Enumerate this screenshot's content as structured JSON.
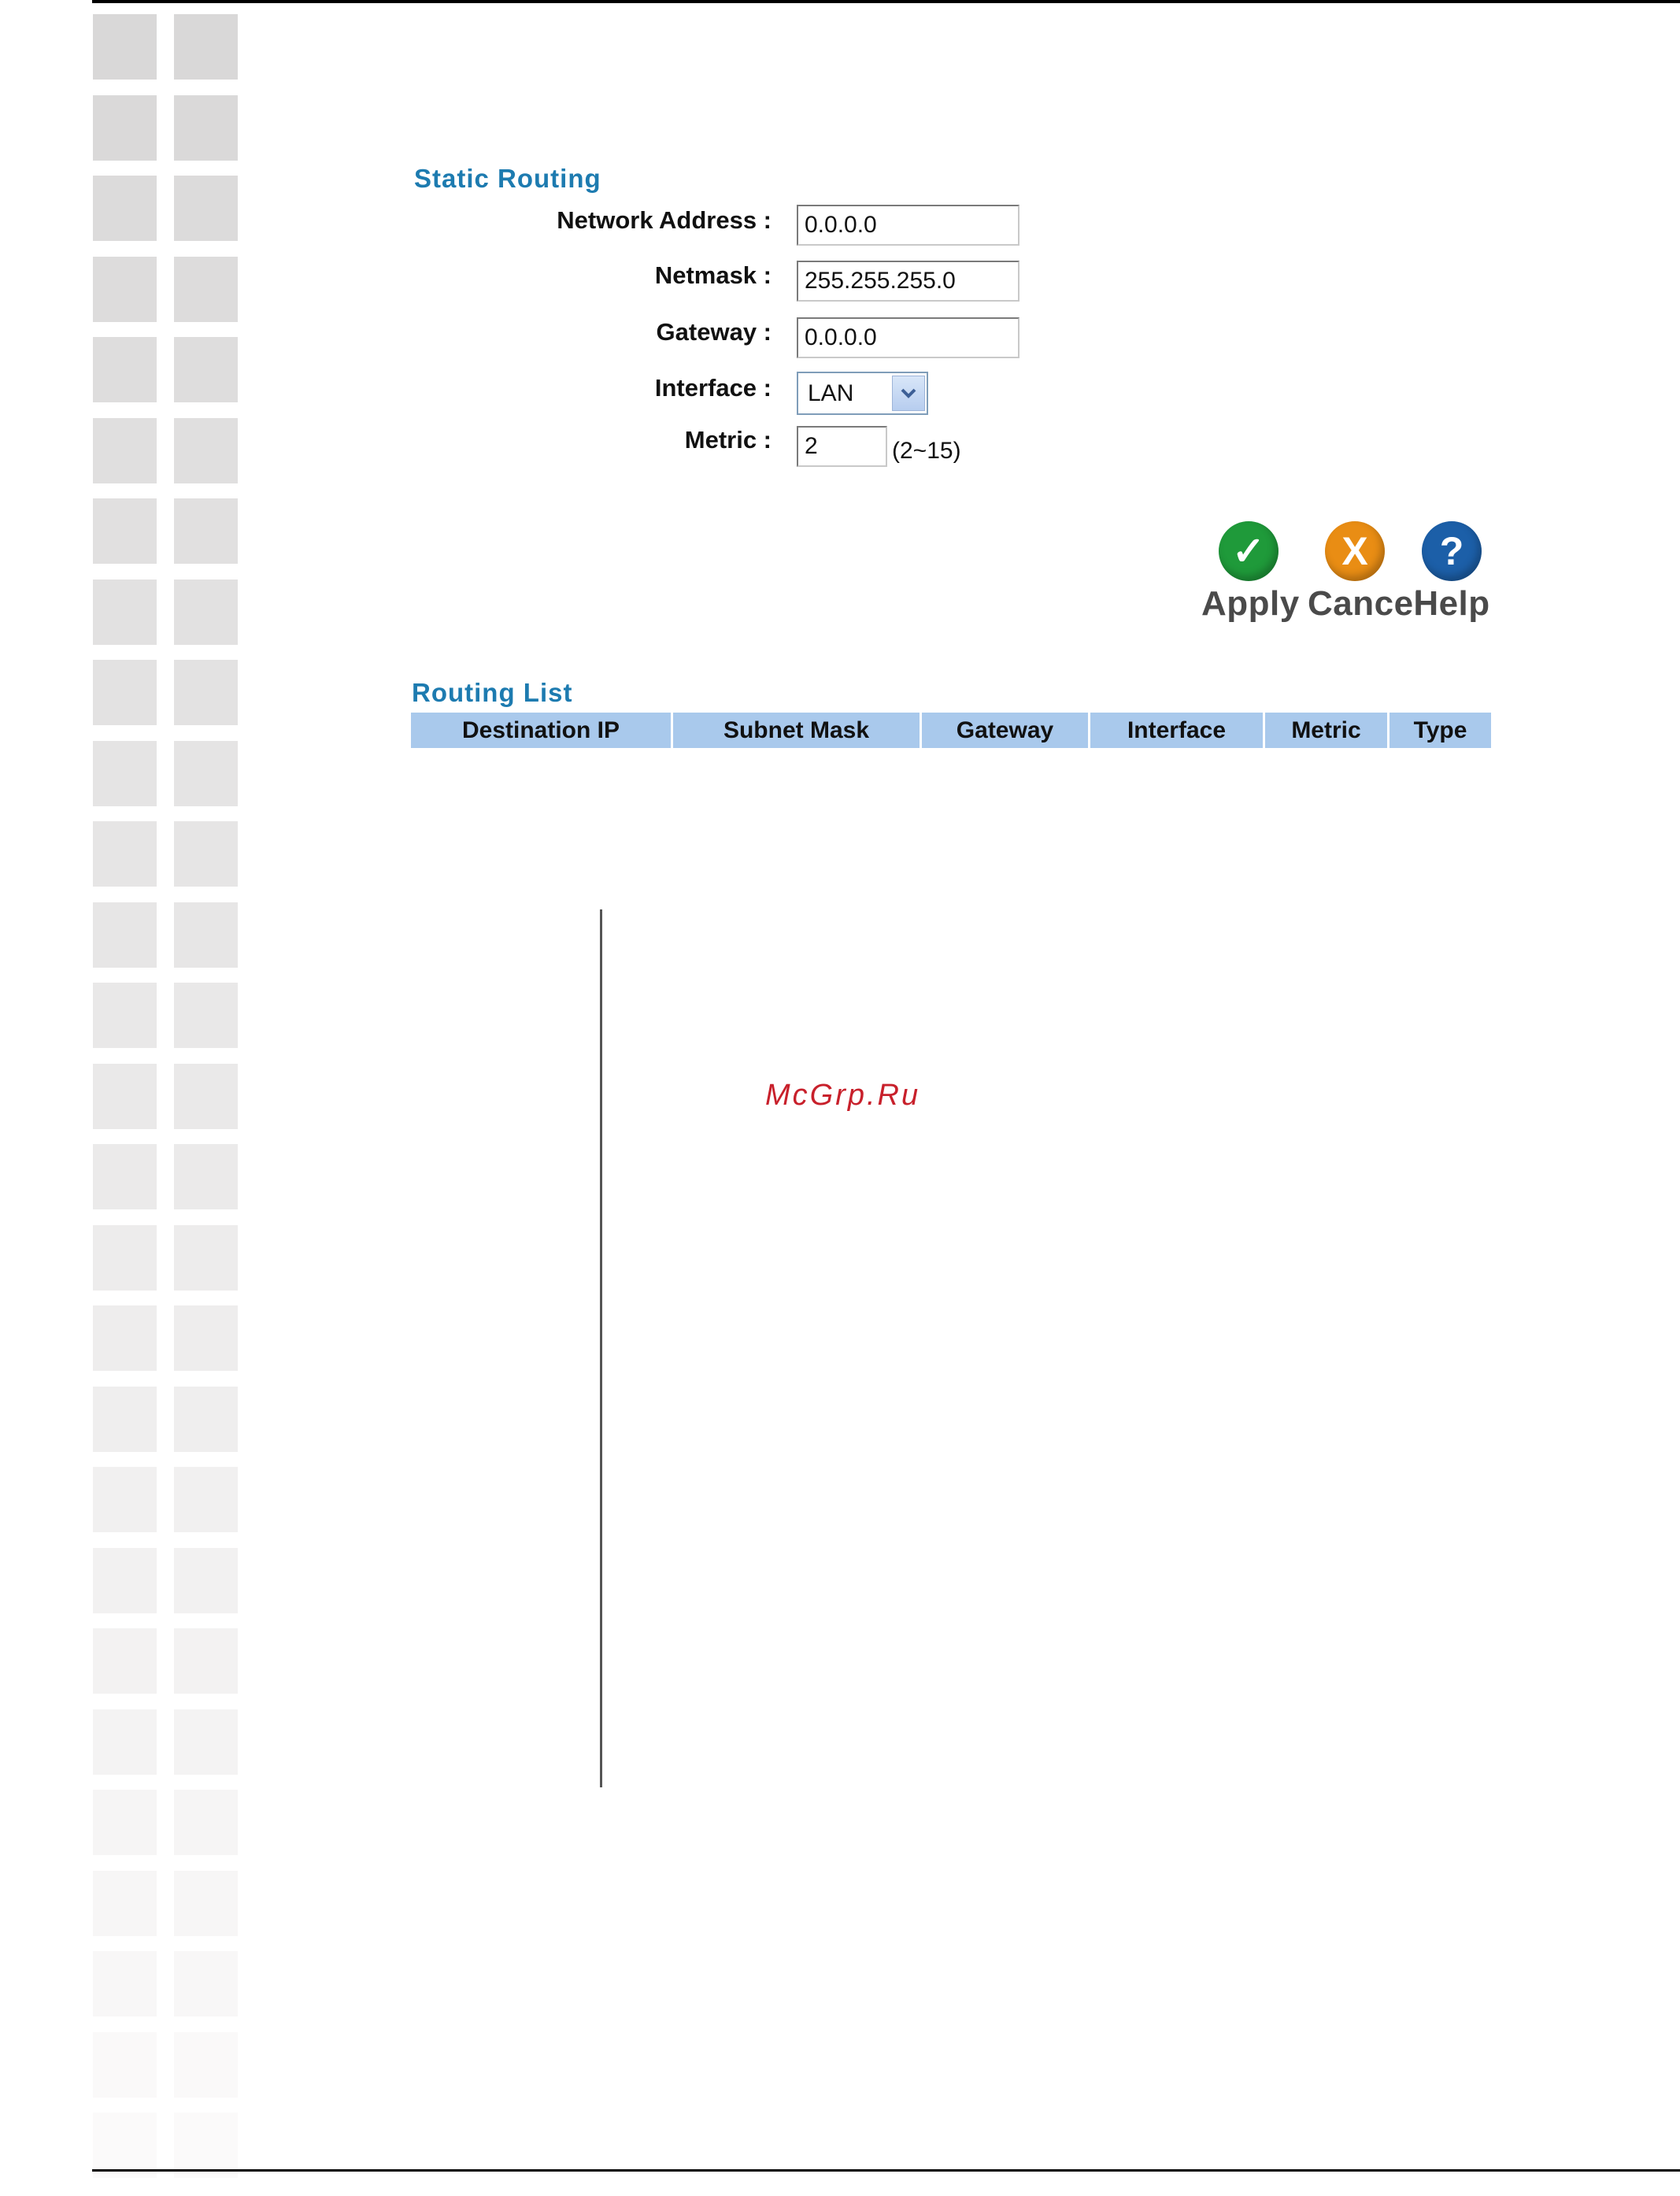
{
  "static_routing": {
    "title": "Static Routing",
    "network_address": {
      "label": "Network Address :",
      "value": "0.0.0.0"
    },
    "netmask": {
      "label": "Netmask :",
      "value": "255.255.255.0"
    },
    "gateway": {
      "label": "Gateway :",
      "value": "0.0.0.0"
    },
    "interface": {
      "label": "Interface :",
      "value": "LAN"
    },
    "metric": {
      "label": "Metric :",
      "value": "2",
      "hint": "(2~15)"
    }
  },
  "actions": {
    "apply": {
      "label": "Apply",
      "icon": "check-icon",
      "color": "#1f9a3a"
    },
    "cancel": {
      "label": "Cancel",
      "icon": "x-icon",
      "color": "#e98d14"
    },
    "help": {
      "label": "Help",
      "icon": "question-icon",
      "color": "#1c5fa8"
    }
  },
  "routing_list": {
    "title": "Routing List",
    "columns": [
      "Destination IP",
      "Subnet Mask",
      "Gateway",
      "Interface",
      "Metric",
      "Type"
    ]
  },
  "watermark": "McGrp.Ru",
  "colors": {
    "section_title": "#1d7bb0",
    "table_header_bg": "#a9c9ec"
  }
}
